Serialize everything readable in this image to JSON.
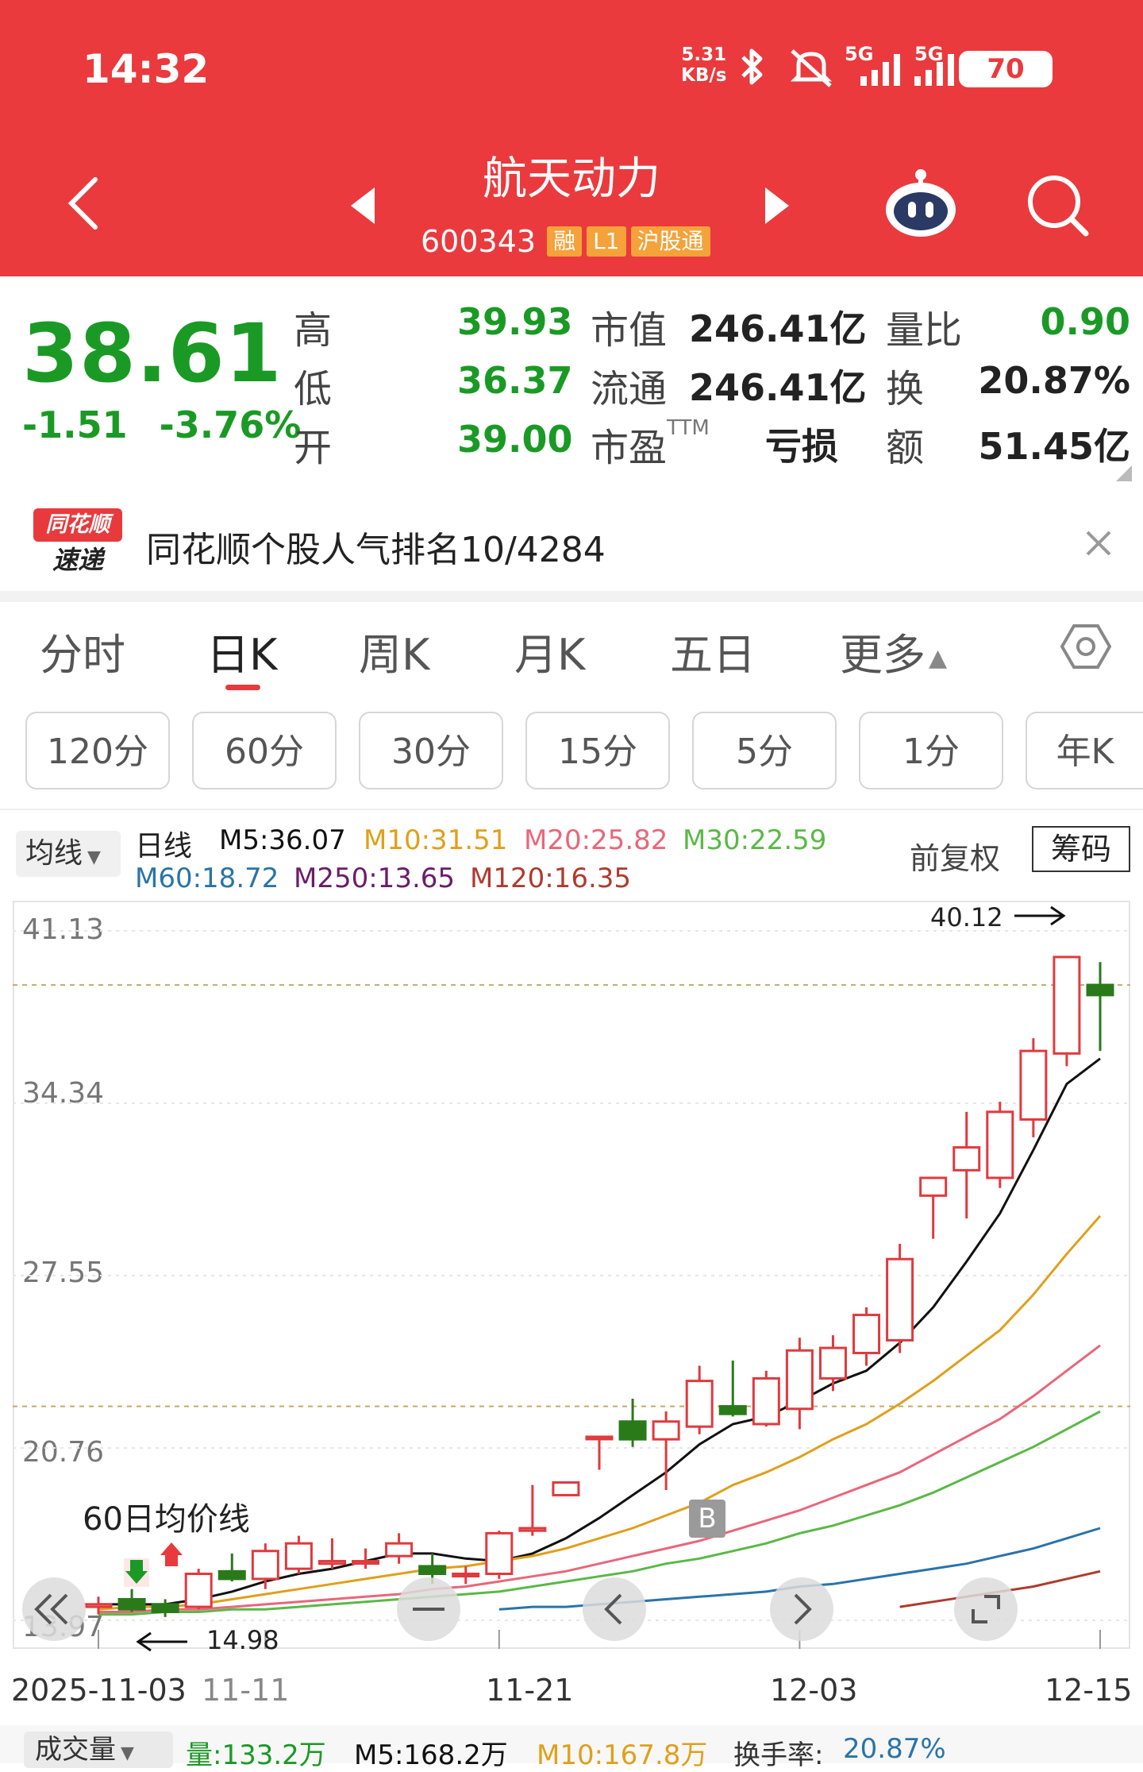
{
  "status_bar": {
    "time": "14:32",
    "net_speed_value": "5.31",
    "net_speed_unit": "KB/s",
    "signal_1": "5G",
    "signal_2": "5G",
    "battery": "70"
  },
  "header": {
    "stock_name": "航天动力",
    "stock_code": "600343",
    "tags": [
      "融",
      "L1",
      "沪股通"
    ]
  },
  "quote": {
    "price": "38.61",
    "change": "-1.51",
    "change_pct": "-3.76%",
    "high_label": "高",
    "high": "39.93",
    "low_label": "低",
    "low": "36.37",
    "open_label": "开",
    "open": "39.00",
    "mktcap_label": "市值",
    "mktcap": "246.41亿",
    "float_label": "流通",
    "float": "246.41亿",
    "pe_label": "市盈",
    "pe_sup": "TTM",
    "pe": "亏损",
    "volratio_label": "量比",
    "volratio": "0.90",
    "turnover_label": "换",
    "turnover": "20.87%",
    "amount_label": "额",
    "amount": "51.45亿"
  },
  "news": {
    "logo_line1": "同花顺",
    "logo_line2": "速递",
    "text": "同花顺个股人气排名10/4284"
  },
  "period_tabs": [
    "分时",
    "日K",
    "周K",
    "月K",
    "五日",
    "更多"
  ],
  "active_tab": "日K",
  "sub_tabs": [
    "120分",
    "60分",
    "30分",
    "15分",
    "5分",
    "1分",
    "年K"
  ],
  "indicator": {
    "selector": "均线",
    "line_type": "日线",
    "ma": [
      {
        "label": "M5:36.07",
        "color": "#111111"
      },
      {
        "label": "M10:31.51",
        "color": "#e0a01b"
      },
      {
        "label": "M20:25.82",
        "color": "#e8677a"
      },
      {
        "label": "M30:22.59",
        "color": "#5ab946"
      },
      {
        "label": "M60:18.72",
        "color": "#2a74a8"
      },
      {
        "label": "M250:13.65",
        "color": "#6b1c6b"
      },
      {
        "label": "M120:16.35",
        "color": "#b03a2e"
      }
    ],
    "adjust": "前复权",
    "chip_button": "筹码"
  },
  "chart_data": {
    "type": "candlestick",
    "y_ticks": [
      "41.13",
      "34.34",
      "27.55",
      "20.76",
      "13.97"
    ],
    "ylim": [
      13.97,
      41.13
    ],
    "x_ticks": [
      "2025-11-03",
      "11-11",
      "11-21",
      "12-03",
      "12-15"
    ],
    "max_label": "40.12",
    "min_label": "14.98",
    "annotation": "60日均价线",
    "buy_marker": "B",
    "candles": [
      {
        "o": 14.5,
        "h": 14.9,
        "l": 14.2,
        "c": 14.6
      },
      {
        "o": 14.8,
        "h": 15.2,
        "l": 14.3,
        "c": 14.4
      },
      {
        "o": 14.6,
        "h": 14.8,
        "l": 14.1,
        "c": 14.3
      },
      {
        "o": 14.5,
        "h": 16.0,
        "l": 14.4,
        "c": 15.8
      },
      {
        "o": 15.9,
        "h": 16.6,
        "l": 15.5,
        "c": 15.6
      },
      {
        "o": 15.6,
        "h": 17.0,
        "l": 15.2,
        "c": 16.7
      },
      {
        "o": 16.0,
        "h": 17.3,
        "l": 15.8,
        "c": 17.0
      },
      {
        "o": 16.2,
        "h": 17.2,
        "l": 16.0,
        "c": 16.3
      },
      {
        "o": 16.3,
        "h": 16.8,
        "l": 16.0,
        "c": 16.3
      },
      {
        "o": 16.5,
        "h": 17.4,
        "l": 16.2,
        "c": 17.0
      },
      {
        "o": 16.1,
        "h": 16.6,
        "l": 15.4,
        "c": 15.8
      },
      {
        "o": 15.8,
        "h": 16.1,
        "l": 15.4,
        "c": 15.8
      },
      {
        "o": 15.8,
        "h": 17.5,
        "l": 15.6,
        "c": 17.4
      },
      {
        "o": 17.5,
        "h": 19.3,
        "l": 17.3,
        "c": 17.6
      },
      {
        "o": 18.9,
        "h": 19.4,
        "l": 18.9,
        "c": 19.4
      },
      {
        "o": 21.2,
        "h": 21.2,
        "l": 19.9,
        "c": 21.2
      },
      {
        "o": 21.8,
        "h": 22.7,
        "l": 20.8,
        "c": 21.1
      },
      {
        "o": 21.1,
        "h": 22.2,
        "l": 19.1,
        "c": 21.8
      },
      {
        "o": 21.6,
        "h": 24.0,
        "l": 21.3,
        "c": 23.4
      },
      {
        "o": 22.4,
        "h": 24.2,
        "l": 22.0,
        "c": 22.1
      },
      {
        "o": 21.7,
        "h": 23.8,
        "l": 21.6,
        "c": 23.5
      },
      {
        "o": 22.3,
        "h": 25.1,
        "l": 21.5,
        "c": 24.6
      },
      {
        "o": 23.5,
        "h": 25.2,
        "l": 23.0,
        "c": 24.7
      },
      {
        "o": 24.5,
        "h": 26.3,
        "l": 24.0,
        "c": 26.0
      },
      {
        "o": 25.0,
        "h": 28.8,
        "l": 24.5,
        "c": 28.2
      },
      {
        "o": 30.7,
        "h": 31.4,
        "l": 29.0,
        "c": 31.4
      },
      {
        "o": 31.7,
        "h": 34.0,
        "l": 29.8,
        "c": 32.6
      },
      {
        "o": 31.4,
        "h": 34.4,
        "l": 31.0,
        "c": 34.0
      },
      {
        "o": 33.7,
        "h": 36.9,
        "l": 33.0,
        "c": 36.4
      },
      {
        "o": 36.3,
        "h": 40.1,
        "l": 35.8,
        "c": 40.1
      },
      {
        "o": 39.0,
        "h": 39.9,
        "l": 36.4,
        "c": 38.6
      }
    ],
    "ma_lines": [
      {
        "name": "M5",
        "color": "#111111",
        "values": [
          14.6,
          14.6,
          14.6,
          14.8,
          15.1,
          15.5,
          15.8,
          16.0,
          16.3,
          16.6,
          16.6,
          16.4,
          16.3,
          16.6,
          17.2,
          18.0,
          18.9,
          19.8,
          20.9,
          21.7,
          22.0,
          22.6,
          23.3,
          23.8,
          24.9,
          26.3,
          28.1,
          30.0,
          32.5,
          35.1,
          36.1
        ]
      },
      {
        "name": "M10",
        "color": "#e0a01b",
        "values": [
          14.4,
          14.5,
          14.5,
          14.6,
          14.8,
          15.0,
          15.2,
          15.4,
          15.6,
          15.8,
          16.0,
          16.1,
          16.3,
          16.5,
          16.8,
          17.2,
          17.6,
          18.1,
          18.6,
          19.3,
          19.8,
          20.4,
          21.1,
          21.7,
          22.5,
          23.4,
          24.4,
          25.4,
          26.8,
          28.4,
          29.9
        ]
      },
      {
        "name": "M20",
        "color": "#e8677a",
        "values": [
          14.3,
          14.3,
          14.4,
          14.4,
          14.5,
          14.6,
          14.7,
          14.8,
          14.9,
          15.0,
          15.2,
          15.3,
          15.5,
          15.7,
          15.9,
          16.2,
          16.5,
          16.8,
          17.1,
          17.5,
          17.9,
          18.3,
          18.8,
          19.3,
          19.8,
          20.5,
          21.2,
          21.9,
          22.8,
          23.8,
          24.8
        ]
      },
      {
        "name": "M30",
        "color": "#5ab946",
        "values": [
          14.2,
          14.2,
          14.3,
          14.3,
          14.4,
          14.4,
          14.5,
          14.6,
          14.7,
          14.8,
          14.9,
          15.0,
          15.1,
          15.3,
          15.5,
          15.7,
          15.9,
          16.2,
          16.4,
          16.7,
          17.0,
          17.4,
          17.7,
          18.1,
          18.5,
          19.0,
          19.6,
          20.2,
          20.8,
          21.5,
          22.2
        ]
      },
      {
        "name": "M60",
        "color": "#2a74a8",
        "values": [
          null,
          null,
          null,
          null,
          null,
          null,
          null,
          null,
          null,
          null,
          null,
          null,
          14.4,
          14.5,
          14.5,
          14.6,
          14.7,
          14.8,
          14.9,
          15.0,
          15.1,
          15.3,
          15.4,
          15.6,
          15.8,
          16.0,
          16.2,
          16.5,
          16.8,
          17.2,
          17.6
        ]
      },
      {
        "name": "M120",
        "color": "#b03a2e",
        "values": [
          null,
          null,
          null,
          null,
          null,
          null,
          null,
          null,
          null,
          null,
          null,
          null,
          null,
          null,
          null,
          null,
          null,
          null,
          null,
          null,
          null,
          null,
          null,
          null,
          14.5,
          14.7,
          14.9,
          15.1,
          15.3,
          15.6,
          15.9
        ]
      }
    ]
  },
  "volume_bar": {
    "selector": "成交量",
    "items": [
      {
        "label": "量:133.2万",
        "color": "#1a9a25"
      },
      {
        "label": "M5:168.2万",
        "color": "#111111"
      },
      {
        "label": "M10:167.8万",
        "color": "#e0a01b"
      },
      {
        "label": "换手率:",
        "color": "#333333"
      },
      {
        "label": "20.87%",
        "color": "#2a74a8"
      }
    ]
  }
}
